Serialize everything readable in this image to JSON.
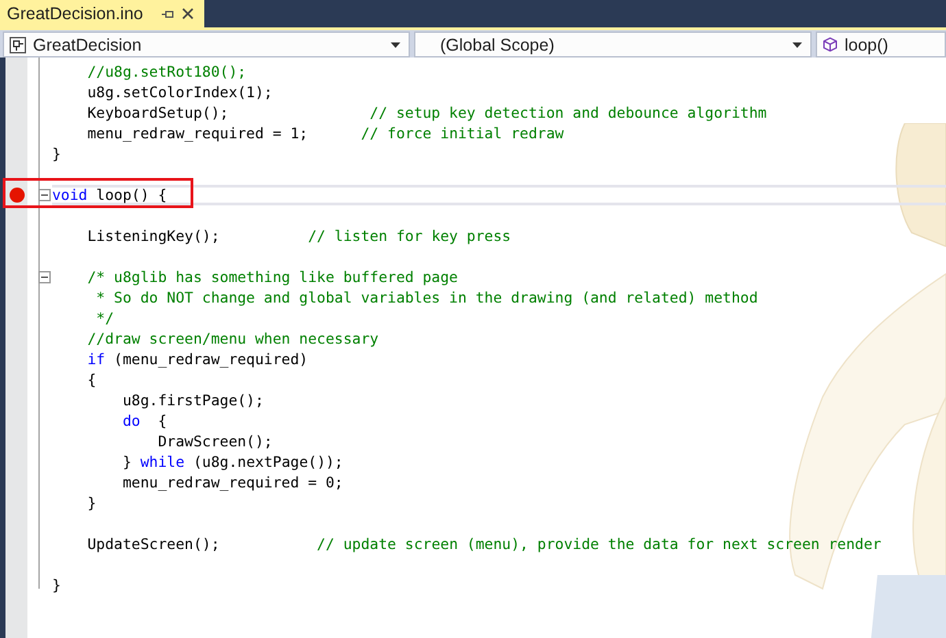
{
  "tab": {
    "title": "GreatDecision.ino",
    "active": true
  },
  "navigation": [
    {
      "kind": "project",
      "label": "GreatDecision"
    },
    {
      "kind": "scope",
      "label": "(Global Scope)"
    },
    {
      "kind": "member",
      "label": "loop()"
    }
  ],
  "lines": [
    {
      "foldable": false,
      "breakpoint": false,
      "current": false,
      "highlighted": false,
      "tokens": [
        {
          "kind": "comment",
          "text": "    //u8g.setRot180();"
        }
      ]
    },
    {
      "foldable": false,
      "breakpoint": false,
      "current": false,
      "highlighted": false,
      "tokens": [
        {
          "kind": "plain",
          "text": "    u8g.setColorIndex(1);"
        }
      ]
    },
    {
      "foldable": false,
      "breakpoint": false,
      "current": false,
      "highlighted": false,
      "tokens": [
        {
          "kind": "plain",
          "text": "    KeyboardSetup();                "
        },
        {
          "kind": "comment",
          "text": "// setup key detection and debounce algorithm"
        }
      ]
    },
    {
      "foldable": false,
      "breakpoint": false,
      "current": false,
      "highlighted": false,
      "tokens": [
        {
          "kind": "plain",
          "text": "    menu_redraw_required = 1;      "
        },
        {
          "kind": "comment",
          "text": "// force initial redraw"
        }
      ]
    },
    {
      "foldable": false,
      "breakpoint": false,
      "current": false,
      "highlighted": false,
      "tokens": [
        {
          "kind": "plain",
          "text": "}"
        }
      ]
    },
    {
      "foldable": false,
      "breakpoint": false,
      "current": false,
      "highlighted": false
    },
    {
      "foldable": true,
      "breakpoint": true,
      "current": true,
      "highlighted": true,
      "tokens": [
        {
          "kind": "keyword",
          "text": "void"
        },
        {
          "kind": "plain",
          "text": " loop() {"
        }
      ]
    },
    {
      "foldable": false,
      "breakpoint": false,
      "current": false,
      "highlighted": false
    },
    {
      "foldable": false,
      "breakpoint": false,
      "current": false,
      "highlighted": false,
      "tokens": [
        {
          "kind": "plain",
          "text": "    ListeningKey();          "
        },
        {
          "kind": "comment",
          "text": "// listen for key press"
        }
      ]
    },
    {
      "foldable": false,
      "breakpoint": false,
      "current": false,
      "highlighted": false
    },
    {
      "foldable": true,
      "breakpoint": false,
      "current": false,
      "highlighted": false,
      "tokens": [
        {
          "kind": "comment",
          "text": "    /* u8glib has something like buffered page"
        }
      ]
    },
    {
      "foldable": false,
      "breakpoint": false,
      "current": false,
      "highlighted": false,
      "tokens": [
        {
          "kind": "comment",
          "text": "     * So do NOT change and global variables in the drawing (and related) method"
        }
      ]
    },
    {
      "foldable": false,
      "breakpoint": false,
      "current": false,
      "highlighted": false,
      "tokens": [
        {
          "kind": "comment",
          "text": "     */"
        }
      ]
    },
    {
      "foldable": false,
      "breakpoint": false,
      "current": false,
      "highlighted": false,
      "tokens": [
        {
          "kind": "comment",
          "text": "    //draw screen/menu when necessary"
        }
      ]
    },
    {
      "foldable": false,
      "breakpoint": false,
      "current": false,
      "highlighted": false,
      "tokens": [
        {
          "kind": "keyword",
          "text": "    if"
        },
        {
          "kind": "plain",
          "text": " (menu_redraw_required)"
        }
      ]
    },
    {
      "foldable": false,
      "breakpoint": false,
      "current": false,
      "highlighted": false,
      "tokens": [
        {
          "kind": "plain",
          "text": "    {"
        }
      ]
    },
    {
      "foldable": false,
      "breakpoint": false,
      "current": false,
      "highlighted": false,
      "tokens": [
        {
          "kind": "plain",
          "text": "        u8g.firstPage();"
        }
      ]
    },
    {
      "foldable": false,
      "breakpoint": false,
      "current": false,
      "highlighted": false,
      "tokens": [
        {
          "kind": "keyword",
          "text": "        do"
        },
        {
          "kind": "plain",
          "text": "  {"
        }
      ]
    },
    {
      "foldable": false,
      "breakpoint": false,
      "current": false,
      "highlighted": false,
      "tokens": [
        {
          "kind": "plain",
          "text": "            DrawScreen();"
        }
      ]
    },
    {
      "foldable": false,
      "breakpoint": false,
      "current": false,
      "highlighted": false,
      "tokens": [
        {
          "kind": "plain",
          "text": "        } "
        },
        {
          "kind": "keyword",
          "text": "while"
        },
        {
          "kind": "plain",
          "text": " (u8g.nextPage());"
        }
      ]
    },
    {
      "foldable": false,
      "breakpoint": false,
      "current": false,
      "highlighted": false,
      "tokens": [
        {
          "kind": "plain",
          "text": "        menu_redraw_required = 0;"
        }
      ]
    },
    {
      "foldable": false,
      "breakpoint": false,
      "current": false,
      "highlighted": false,
      "tokens": [
        {
          "kind": "plain",
          "text": "    }"
        }
      ]
    },
    {
      "foldable": false,
      "breakpoint": false,
      "current": false,
      "highlighted": false
    },
    {
      "foldable": false,
      "breakpoint": false,
      "current": false,
      "highlighted": false,
      "tokens": [
        {
          "kind": "plain",
          "text": "    UpdateScreen();           "
        },
        {
          "kind": "comment",
          "text": "// update screen (menu), provide the data for next screen render"
        }
      ]
    },
    {
      "foldable": false,
      "breakpoint": false,
      "current": false,
      "highlighted": false
    },
    {
      "foldable": false,
      "breakpoint": false,
      "current": false,
      "highlighted": false,
      "tokens": [
        {
          "kind": "plain",
          "text": "}"
        }
      ]
    }
  ]
}
